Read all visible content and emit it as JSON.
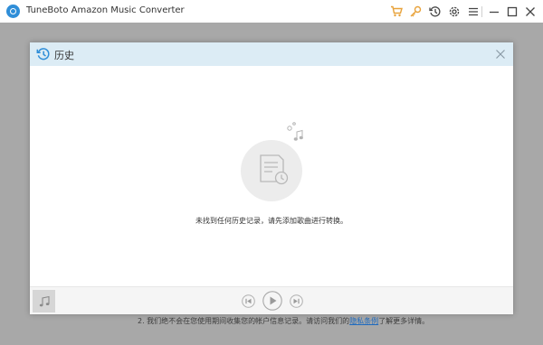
{
  "app": {
    "title": "TuneBoto Amazon Music Converter"
  },
  "toolbar": {
    "icons": [
      "cart-icon",
      "key-icon",
      "history-icon",
      "gear-icon",
      "menu-icon",
      "minimize-icon",
      "maximize-icon",
      "close-icon"
    ]
  },
  "modal": {
    "title": "历史",
    "empty_message": "未找到任何历史记录，请先添加歌曲进行转换。"
  },
  "background": {
    "notice_prefix": "2. 我们绝不会在您使用期间收集您的帐户信息记录。请访问我们的",
    "notice_link": "隐私条例",
    "notice_suffix": "了解更多详情。"
  },
  "colors": {
    "accent": "#2f8ed8",
    "header": "#dcecf5",
    "cart": "#e8a23a",
    "link": "#1f6bbf"
  }
}
